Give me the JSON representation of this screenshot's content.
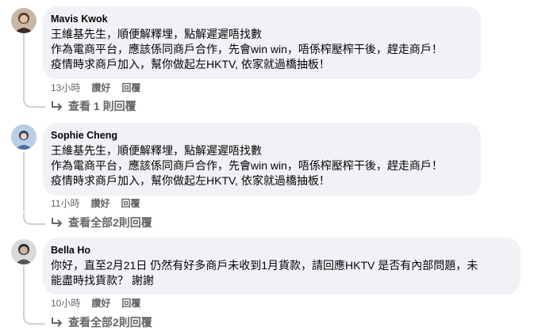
{
  "comments": [
    {
      "author": "Mavis Kwok",
      "lines": [
        "王維基先生，順便解釋埋，點解遲遲唔找數",
        "作為電商平台，應該係同商戶合作，先會win win，唔係榨壓榨干後，趕走商戶！",
        "疫情時求商戶加入，幫你做起左HKTV, 依家就過橋抽板！"
      ],
      "time": "13小時",
      "like_label": "讚好",
      "reply_label": "回覆",
      "view_replies": "查看 1 則回覆"
    },
    {
      "author": "Sophie Cheng",
      "lines": [
        "王維基先生，順便解釋埋，點解遲遲唔找數",
        "作為電商平台，應該係同商戶合作，先會win win，唔係榨壓榨干後，趕走商戶！",
        "疫情時求商戶加入，幫你做起左HKTV, 依家就過橋抽板！"
      ],
      "time": "11小時",
      "like_label": "讚好",
      "reply_label": "回覆",
      "view_replies": "查看全部2則回覆"
    },
    {
      "author": "Bella Ho",
      "lines": [
        "你好，直至2月21日 仍然有好多商戶未收到1月貨款，請回應HKTV 是否有內部問題，未",
        "能盡時找貨款？ 謝謝"
      ],
      "time": "10小時",
      "like_label": "讚好",
      "reply_label": "回覆",
      "view_replies": "查看全部2則回覆"
    }
  ],
  "colors": {
    "bubble": "#f0f2f5",
    "secondary_text": "#65676b",
    "thread_line": "#ced0d4"
  },
  "icons": {
    "avatar_1": "avatar-photo-icon",
    "avatar_2": "avatar-photo-icon",
    "avatar_3": "avatar-photo-icon",
    "reply_arrow": "reply-arrow-icon"
  }
}
